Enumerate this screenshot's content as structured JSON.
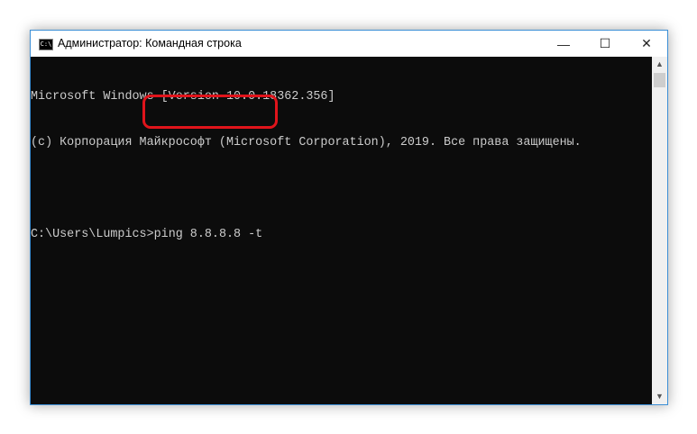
{
  "window": {
    "title": "Администратор: Командная строка",
    "icon": "cmd-icon",
    "border_color": "#3c8fd6"
  },
  "controls": {
    "minimize": "—",
    "maximize": "☐",
    "close": "✕"
  },
  "console": {
    "lines": [
      "Microsoft Windows [Version 10.0.18362.356]",
      "(c) Корпорация Майкрософт (Microsoft Corporation), 2019. Все права защищены.",
      ""
    ],
    "prompt": "C:\\Users\\Lumpics",
    "command": "ping 8.8.8.8 -t"
  },
  "highlight": {
    "color": "#e0141b"
  }
}
